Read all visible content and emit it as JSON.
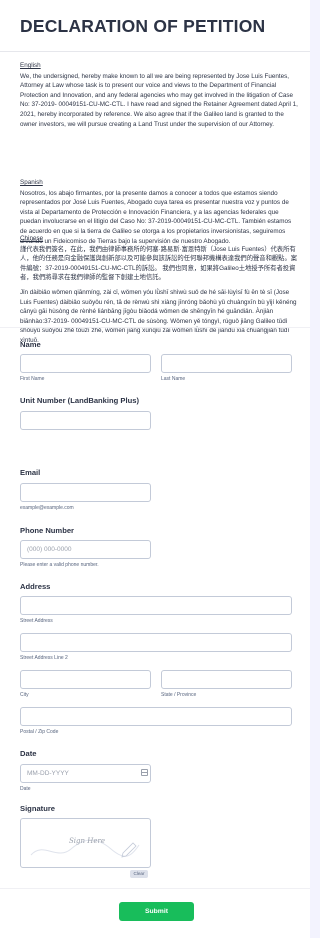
{
  "title": "DECLARATION OF PETITION",
  "english": {
    "label": "English",
    "text": "We, the undersigned, hereby make known to all we are being represented by Jose Luis Fuentes, Attorney at Law whose task is to present our voice and views to the Department of Financial Protection and Innovation, and any federal agencies who may get involved in the litigation of Case No: 37-2019- 00049151-CU-MC-CTL. I have read and signed the Retainer Agreement dated April 1, 2021, hereby incorporated by reference. We also agree that if the Galileo land is granted to the owner investors, we will pursue creating a Land Trust under the supervision of our Attorney."
  },
  "spanish": {
    "label": "Spanish",
    "text": "Nosotros, los abajo firmantes, por la presente damos a conocer a todos que estamos siendo representados por José Luis Fuentes, Abogado cuya tarea es presentar nuestra voz y puntos de vista al Departamento de Protección e Innovación Financiera, y a las agencias federales que puedan involucrarse en el litigio del Caso No: 37-2019-00049151-CU-MC-CTL. También estamos de acuerdo en que si la tierra de Galileo se otorga a los propietarios inversionistas, seguiremos creando un Fideicomiso de Tierras bajo la supervisión de nuestro Abogado."
  },
  "chinese": {
    "label": "Chinese",
    "text1": "謹代表我們簽名，在此，我們由律師事務所的何塞·路易斯·富恩特斯（Jose Luis Fuentes）代表所有人，他的任務是向金融保護與創新部以及可能參與該訴訟的任何聯邦機構表達我們的聲音和觀點。案件編號：37-2019-00049151-CU-MC-CTL的訴訟。 我們也同意，如果將Galileo土地授予所有者投資者，我們將尋求在我們律師的監督下創建土地信託。",
    "text2": "Jǐn dàibiǎo wǒmen qiānmíng, zài cǐ, wǒmen yóu lǜshī shìwù suǒ de hé sāi·lùyìsī fù ēn tè sī (Jose Luis Fuentes) dàibiǎo suǒyǒu rén, tā de rènwù shì xiàng jīnróng bǎohù yǔ chuàngxīn bù yǐjí kěnéng cānyù gāi hùsòng de rènhé liánbāng jīgòu biǎodá wǒmen de shēngyīn hé guāndiǎn. Ànjiàn biānhào:37-2019- 00049151-CU-MC-CTL de sùsòng. Wǒmen yě tóngyì, rúguǒ jiāng Galileo tǔdì shòuyǔ suǒyǒu zhě tóuzī zhě, wǒmen jiāng xúnqiú zài wǒmen lǜshī de jiāndū xià chuàngjiàn tǔdì xìntuō."
  },
  "form": {
    "name": {
      "label": "Name",
      "first_sub": "First Name",
      "last_sub": "Last Name"
    },
    "unit": {
      "label": "Unit Number (LandBanking Plus)"
    },
    "email": {
      "label": "Email",
      "sub": "example@example.com"
    },
    "phone": {
      "label": "Phone Number",
      "placeholder": "(000) 000-0000",
      "sub": "Please enter a valid phone number."
    },
    "address": {
      "label": "Address",
      "street_sub": "Street Address",
      "street2_sub": "Street Address Line 2",
      "city_sub": "City",
      "state_sub": "State / Province",
      "postal_sub": "Postal / Zip Code"
    },
    "date": {
      "label": "Date",
      "placeholder": "MM-DD-YYYY",
      "sub": "Date"
    },
    "signature": {
      "label": "Signature",
      "placeholder": "Sign Here",
      "clear": "Clear"
    },
    "submit": "Submit"
  }
}
